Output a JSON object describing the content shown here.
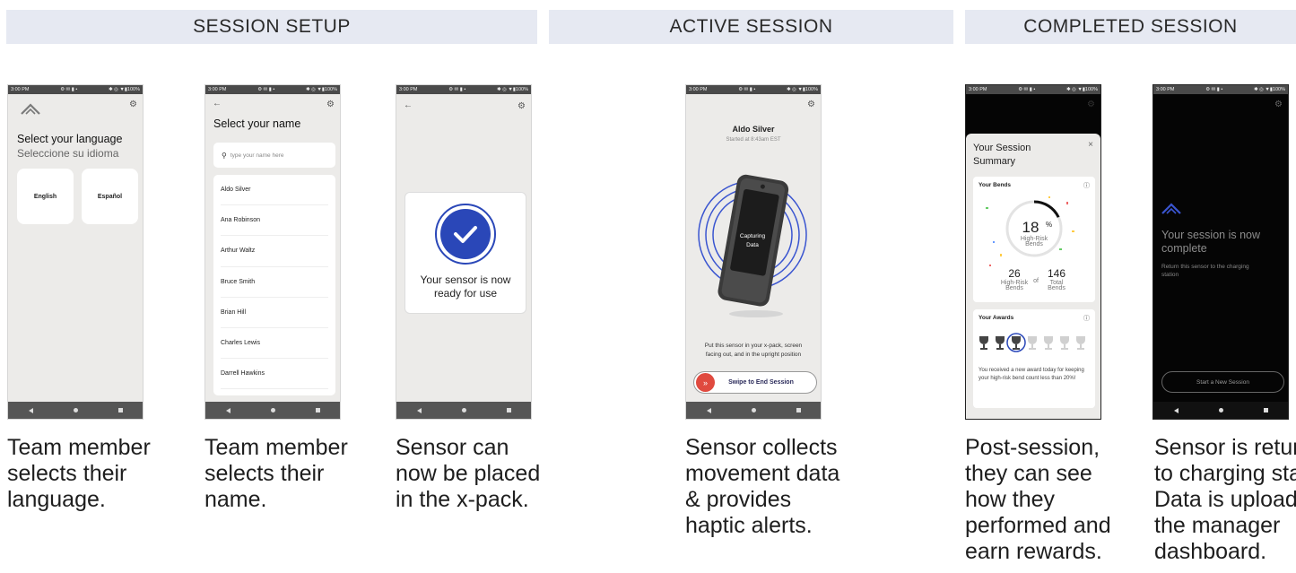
{
  "sections": {
    "setup": "SESSION SETUP",
    "active": "ACTIVE SESSION",
    "completed": "COMPLETED SESSION"
  },
  "status_bar": {
    "time": "3:00 PM",
    "icons": "⚙ ✉ ▮ •",
    "battery": "✱ ◎ ▼▮100%"
  },
  "phone1": {
    "title": "Select your language",
    "subtitle": "Seleccione su idioma",
    "buttons": [
      "English",
      "Español"
    ]
  },
  "phone2": {
    "title": "Select your name",
    "search_placeholder": "type your name here",
    "names": [
      "Aldo Silver",
      "Ana Robinson",
      "Arthur Waltz",
      "Bruce Smith",
      "Brian Hill",
      "Charles Lewis",
      "Darrell Hawkins"
    ]
  },
  "phone3": {
    "ready_text": "Your sensor is now\nready for use"
  },
  "phone4": {
    "name": "Aldo Silver",
    "started": "Started at 8:43am EST",
    "capturing_line1": "Capturing",
    "capturing_line2": "Data",
    "instruction": "Put this sensor in your x-pack, screen\nfacing out, and in the upright position",
    "swipe_label": "Swipe to End Session",
    "swipe_icon": "»"
  },
  "phone5": {
    "title": "Your Session\nSummary",
    "close": "×",
    "bends": {
      "title": "Your Bends",
      "info": "ⓘ",
      "percent_value": "18",
      "percent_sign": "%",
      "percent_label_1": "High-Risk",
      "percent_label_2": "Bends",
      "high_risk": "26",
      "high_risk_label_1": "High-Risk",
      "high_risk_label_2": "Bends",
      "of": "of",
      "total": "146",
      "total_label_1": "Total",
      "total_label_2": "Bends",
      "ring_fraction": 0.18
    },
    "awards": {
      "title": "Your Awards",
      "info": "ⓘ",
      "earned_count": 3,
      "total_count": 7,
      "text": "You received a new award today for keeping your high-risk bend count less than 20%!"
    }
  },
  "phone6": {
    "title": "Your session is now\ncomplete",
    "subtitle": "Return this sensor to the charging\nstation",
    "button": "Start a New Session"
  },
  "captions": {
    "c1": "Team member\nselects their\nlanguage.",
    "c2": "Team member\nselects their\nname.",
    "c3": "Sensor can\nnow be placed\nin the x-pack.",
    "c4": "Sensor collects\nmovement data\n& provides\nhaptic alerts.",
    "c5": "Post-session,\nthey can see\nhow they\nperformed and\nearn rewards.",
    "c6": "Sensor is returned\nto charging station.\nData is uploaded to\nthe manager\ndashboard."
  },
  "colors": {
    "accent_blue": "#2a47b8",
    "swipe_red": "#e04a3f",
    "header_bg": "#e6e9f2"
  }
}
